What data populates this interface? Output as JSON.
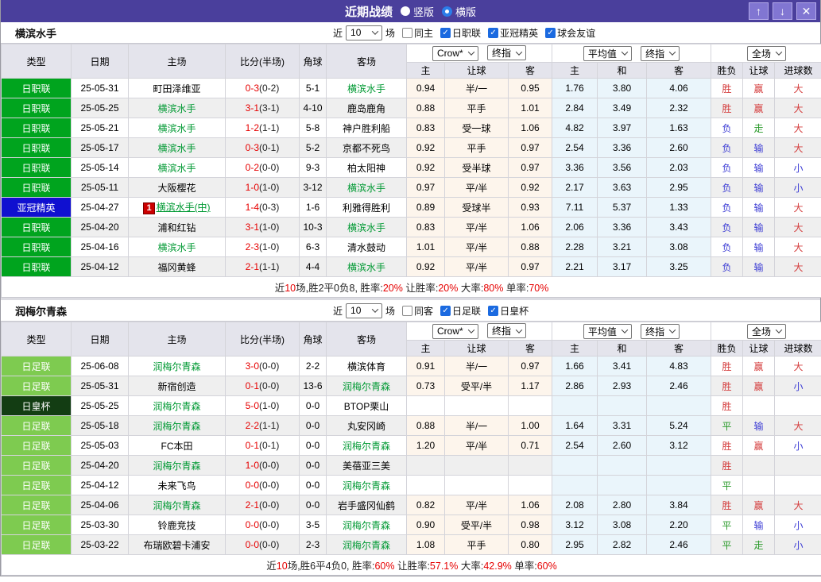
{
  "titlebar": {
    "title": "近期战绩",
    "vertical_label": "竖版",
    "horizontal_label": "横版",
    "selected_layout": "横版",
    "buttons": {
      "up": "↑",
      "down": "↓",
      "close": "✕"
    }
  },
  "table_header": {
    "left_cols": [
      "类型",
      "日期",
      "主场",
      "比分(半场)",
      "角球",
      "客场"
    ],
    "sub_cols": [
      "主",
      "让球",
      "客",
      "主",
      "和",
      "客",
      "胜负",
      "让球",
      "进球数"
    ],
    "selects": [
      "Crow*",
      "终指",
      "平均值",
      "终指",
      "全场"
    ]
  },
  "league_colors": {
    "日职联": "#00a41e",
    "亚冠精英": "#1010d0",
    "日足联": "#7ecb50",
    "日皇杯": "#133d13"
  },
  "result_colors": {
    "胜": "#d43c3c",
    "平": "#2a9a2a",
    "负": "#3c3cd4",
    "赢": "#d43c3c",
    "走": "#2a9a2a",
    "输": "#3c3cd4",
    "大": "#d43c3c",
    "小": "#3c3cd4"
  },
  "accent_colors": {
    "titlebar_bg": "#4a3f9c",
    "score_red": "#e60000",
    "team_green": "#009933",
    "checkbox_blue": "#1b6ae0"
  },
  "sections": [
    {
      "team": "横滨水手",
      "filters": {
        "recent_label": "近",
        "count": "10",
        "games_label": "场",
        "checkboxes": [
          {
            "label": "同主",
            "checked": false
          },
          {
            "label": "日职联",
            "checked": true
          },
          {
            "label": "亚冠精英",
            "checked": true
          },
          {
            "label": "球会友谊",
            "checked": true
          }
        ]
      },
      "rows": [
        {
          "league": "日职联",
          "date": "25-05-31",
          "home": "町田泽维亚",
          "home_subject": false,
          "score": "0-3",
          "half": "(0-2)",
          "corners": "5-1",
          "away": "横滨水手",
          "away_subject": true,
          "crow": [
            "0.94",
            "半/一",
            "0.95"
          ],
          "avg": [
            "1.76",
            "3.80",
            "4.06"
          ],
          "results": [
            "胜",
            "赢",
            "大"
          ]
        },
        {
          "league": "日职联",
          "date": "25-05-25",
          "home": "横滨水手",
          "home_subject": true,
          "score": "3-1",
          "half": "(3-1)",
          "corners": "4-10",
          "away": "鹿岛鹿角",
          "away_subject": false,
          "crow": [
            "0.88",
            "平手",
            "1.01"
          ],
          "avg": [
            "2.84",
            "3.49",
            "2.32"
          ],
          "results": [
            "胜",
            "赢",
            "大"
          ]
        },
        {
          "league": "日职联",
          "date": "25-05-21",
          "home": "横滨水手",
          "home_subject": true,
          "score": "1-2",
          "half": "(1-1)",
          "corners": "5-8",
          "away": "神户胜利船",
          "away_subject": false,
          "crow": [
            "0.83",
            "受一球",
            "1.06"
          ],
          "avg": [
            "4.82",
            "3.97",
            "1.63"
          ],
          "results": [
            "负",
            "走",
            "大"
          ]
        },
        {
          "league": "日职联",
          "date": "25-05-17",
          "home": "横滨水手",
          "home_subject": true,
          "score": "0-3",
          "half": "(0-1)",
          "corners": "5-2",
          "away": "京都不死鸟",
          "away_subject": false,
          "crow": [
            "0.92",
            "平手",
            "0.97"
          ],
          "avg": [
            "2.54",
            "3.36",
            "2.60"
          ],
          "results": [
            "负",
            "输",
            "大"
          ]
        },
        {
          "league": "日职联",
          "date": "25-05-14",
          "home": "横滨水手",
          "home_subject": true,
          "score": "0-2",
          "half": "(0-0)",
          "corners": "9-3",
          "away": "柏太阳神",
          "away_subject": false,
          "crow": [
            "0.92",
            "受半球",
            "0.97"
          ],
          "avg": [
            "3.36",
            "3.56",
            "2.03"
          ],
          "results": [
            "负",
            "输",
            "小"
          ]
        },
        {
          "league": "日职联",
          "date": "25-05-11",
          "home": "大阪樱花",
          "home_subject": false,
          "score": "1-0",
          "half": "(1-0)",
          "corners": "3-12",
          "away": "横滨水手",
          "away_subject": true,
          "crow": [
            "0.97",
            "平/半",
            "0.92"
          ],
          "avg": [
            "2.17",
            "3.63",
            "2.95"
          ],
          "results": [
            "负",
            "输",
            "小"
          ]
        },
        {
          "league": "亚冠精英",
          "date": "25-04-27",
          "home": "横滨水手(中)",
          "home_subject": true,
          "home_prefix": "1",
          "home_underline": true,
          "score": "1-4",
          "half": "(0-3)",
          "corners": "1-6",
          "away": "利雅得胜利",
          "away_subject": false,
          "crow": [
            "0.89",
            "受球半",
            "0.93"
          ],
          "avg": [
            "7.11",
            "5.37",
            "1.33"
          ],
          "results": [
            "负",
            "输",
            "大"
          ]
        },
        {
          "league": "日职联",
          "date": "25-04-20",
          "home": "浦和红钻",
          "home_subject": false,
          "score": "3-1",
          "half": "(1-0)",
          "corners": "10-3",
          "away": "横滨水手",
          "away_subject": true,
          "crow": [
            "0.83",
            "平/半",
            "1.06"
          ],
          "avg": [
            "2.06",
            "3.36",
            "3.43"
          ],
          "results": [
            "负",
            "输",
            "大"
          ]
        },
        {
          "league": "日职联",
          "date": "25-04-16",
          "home": "横滨水手",
          "home_subject": true,
          "score": "2-3",
          "half": "(1-0)",
          "corners": "6-3",
          "away": "清水鼓动",
          "away_subject": false,
          "crow": [
            "1.01",
            "平/半",
            "0.88"
          ],
          "avg": [
            "2.28",
            "3.21",
            "3.08"
          ],
          "results": [
            "负",
            "输",
            "大"
          ]
        },
        {
          "league": "日职联",
          "date": "25-04-12",
          "home": "福冈黄蜂",
          "home_subject": false,
          "score": "2-1",
          "half": "(1-1)",
          "corners": "4-4",
          "away": "横滨水手",
          "away_subject": true,
          "crow": [
            "0.92",
            "平/半",
            "0.97"
          ],
          "avg": [
            "2.21",
            "3.17",
            "3.25"
          ],
          "results": [
            "负",
            "输",
            "大"
          ]
        }
      ],
      "summary": [
        {
          "text": "近"
        },
        {
          "text": "10",
          "red": true
        },
        {
          "text": "场,胜2平0负8, 胜率:"
        },
        {
          "text": "20%",
          "red": true
        },
        {
          "text": " 让胜率:"
        },
        {
          "text": "20%",
          "red": true
        },
        {
          "text": " 大率:"
        },
        {
          "text": "80%",
          "red": true
        },
        {
          "text": " 单率:"
        },
        {
          "text": "70%",
          "red": true
        }
      ]
    },
    {
      "team": "润梅尔青森",
      "filters": {
        "recent_label": "近",
        "count": "10",
        "games_label": "场",
        "checkboxes": [
          {
            "label": "同客",
            "checked": false
          },
          {
            "label": "日足联",
            "checked": true
          },
          {
            "label": "日皇杯",
            "checked": true
          }
        ]
      },
      "rows": [
        {
          "league": "日足联",
          "date": "25-06-08",
          "home": "润梅尔青森",
          "home_subject": true,
          "score": "3-0",
          "half": "(0-0)",
          "corners": "2-2",
          "away": "横滨体育",
          "away_subject": false,
          "crow": [
            "0.91",
            "半/一",
            "0.97"
          ],
          "avg": [
            "1.66",
            "3.41",
            "4.83"
          ],
          "results": [
            "胜",
            "赢",
            "大"
          ]
        },
        {
          "league": "日足联",
          "date": "25-05-31",
          "home": "新宿创造",
          "home_subject": false,
          "score": "0-1",
          "half": "(0-0)",
          "corners": "13-6",
          "away": "润梅尔青森",
          "away_subject": true,
          "crow": [
            "0.73",
            "受平/半",
            "1.17"
          ],
          "avg": [
            "2.86",
            "2.93",
            "2.46"
          ],
          "results": [
            "胜",
            "赢",
            "小"
          ]
        },
        {
          "league": "日皇杯",
          "date": "25-05-25",
          "home": "润梅尔青森",
          "home_subject": true,
          "score": "5-0",
          "half": "(1-0)",
          "corners": "0-0",
          "away": "BTOP栗山",
          "away_subject": false,
          "crow": [
            "",
            "",
            ""
          ],
          "avg": [
            "",
            "",
            ""
          ],
          "results": [
            "胜",
            "",
            ""
          ]
        },
        {
          "league": "日足联",
          "date": "25-05-18",
          "home": "润梅尔青森",
          "home_subject": true,
          "score": "2-2",
          "half": "(1-1)",
          "corners": "0-0",
          "away": "丸安冈崎",
          "away_subject": false,
          "crow": [
            "0.88",
            "半/一",
            "1.00"
          ],
          "avg": [
            "1.64",
            "3.31",
            "5.24"
          ],
          "results": [
            "平",
            "输",
            "大"
          ]
        },
        {
          "league": "日足联",
          "date": "25-05-03",
          "home": "FC本田",
          "home_subject": false,
          "score": "0-1",
          "half": "(0-1)",
          "corners": "0-0",
          "away": "润梅尔青森",
          "away_subject": true,
          "crow": [
            "1.20",
            "平/半",
            "0.71"
          ],
          "avg": [
            "2.54",
            "2.60",
            "3.12"
          ],
          "results": [
            "胜",
            "赢",
            "小"
          ]
        },
        {
          "league": "日足联",
          "date": "25-04-20",
          "home": "润梅尔青森",
          "home_subject": true,
          "score": "1-0",
          "half": "(0-0)",
          "corners": "0-0",
          "away": "美蓓亚三美",
          "away_subject": false,
          "crow": [
            "",
            "",
            ""
          ],
          "avg": [
            "",
            "",
            ""
          ],
          "results": [
            "胜",
            "",
            ""
          ]
        },
        {
          "league": "日足联",
          "date": "25-04-12",
          "home": "未来飞鸟",
          "home_subject": false,
          "score": "0-0",
          "half": "(0-0)",
          "corners": "0-0",
          "away": "润梅尔青森",
          "away_subject": true,
          "crow": [
            "",
            "",
            ""
          ],
          "avg": [
            "",
            "",
            ""
          ],
          "results": [
            "平",
            "",
            ""
          ]
        },
        {
          "league": "日足联",
          "date": "25-04-06",
          "home": "润梅尔青森",
          "home_subject": true,
          "score": "2-1",
          "half": "(0-0)",
          "corners": "0-0",
          "away": "岩手盛冈仙鹤",
          "away_subject": false,
          "crow": [
            "0.82",
            "平/半",
            "1.06"
          ],
          "avg": [
            "2.08",
            "2.80",
            "3.84"
          ],
          "results": [
            "胜",
            "赢",
            "大"
          ]
        },
        {
          "league": "日足联",
          "date": "25-03-30",
          "home": "铃鹿竞技",
          "home_subject": false,
          "score": "0-0",
          "half": "(0-0)",
          "corners": "3-5",
          "away": "润梅尔青森",
          "away_subject": true,
          "crow": [
            "0.90",
            "受平/半",
            "0.98"
          ],
          "avg": [
            "3.12",
            "3.08",
            "2.20"
          ],
          "results": [
            "平",
            "输",
            "小"
          ]
        },
        {
          "league": "日足联",
          "date": "25-03-22",
          "home": "布瑞欧碧卡浦安",
          "home_subject": false,
          "score": "0-0",
          "half": "(0-0)",
          "corners": "2-3",
          "away": "润梅尔青森",
          "away_subject": true,
          "crow": [
            "1.08",
            "平手",
            "0.80"
          ],
          "avg": [
            "2.95",
            "2.82",
            "2.46"
          ],
          "results": [
            "平",
            "走",
            "小"
          ]
        }
      ],
      "summary": [
        {
          "text": "近"
        },
        {
          "text": "10",
          "red": true
        },
        {
          "text": "场,胜6平4负0, 胜率:"
        },
        {
          "text": "60%",
          "red": true
        },
        {
          "text": " 让胜率:"
        },
        {
          "text": "57.1%",
          "red": true
        },
        {
          "text": " 大率:"
        },
        {
          "text": "42.9%",
          "red": true
        },
        {
          "text": " 单率:"
        },
        {
          "text": "60%",
          "red": true
        }
      ]
    }
  ]
}
